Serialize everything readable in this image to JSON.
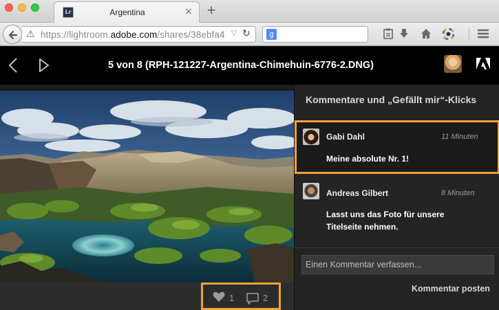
{
  "browser": {
    "tab_title": "Argentina",
    "tab_favicon": "Lr",
    "tab_close": "×",
    "new_tab": "+",
    "url_prefix": "https://lightroom.",
    "url_domain": "adobe.com",
    "url_suffix": "/shares/38ebfa4",
    "search_engine_icon": "g",
    "icons": [
      "back-icon",
      "warning-icon",
      "reload-icon",
      "bookmarks-icon",
      "download-icon",
      "home-icon",
      "color-wheel-icon",
      "menu-icon"
    ]
  },
  "header": {
    "title": "5 von 8 (RPH-121227-Argentina-Chimehuin-6776-2.DNG)"
  },
  "photo": {
    "likes": "1",
    "comments": "2"
  },
  "panel": {
    "heading": "Kommentare und „Gefällt mir“-Klicks",
    "comments": [
      {
        "name": "Gabi Dahl",
        "time": "11 Minuten",
        "text": "Meine absolute Nr. 1!"
      },
      {
        "name": "Andreas Gilbert",
        "time": "8 Minuten",
        "text": "Lasst uns das Foto für unsere Titelseite nehmen."
      }
    ],
    "input_placeholder": "Einen Kommentar verfassen...",
    "post_label": "Kommentar posten"
  },
  "colors": {
    "highlight": "#f1a23b",
    "panel_bg": "#242424",
    "header_bg": "#000000"
  }
}
